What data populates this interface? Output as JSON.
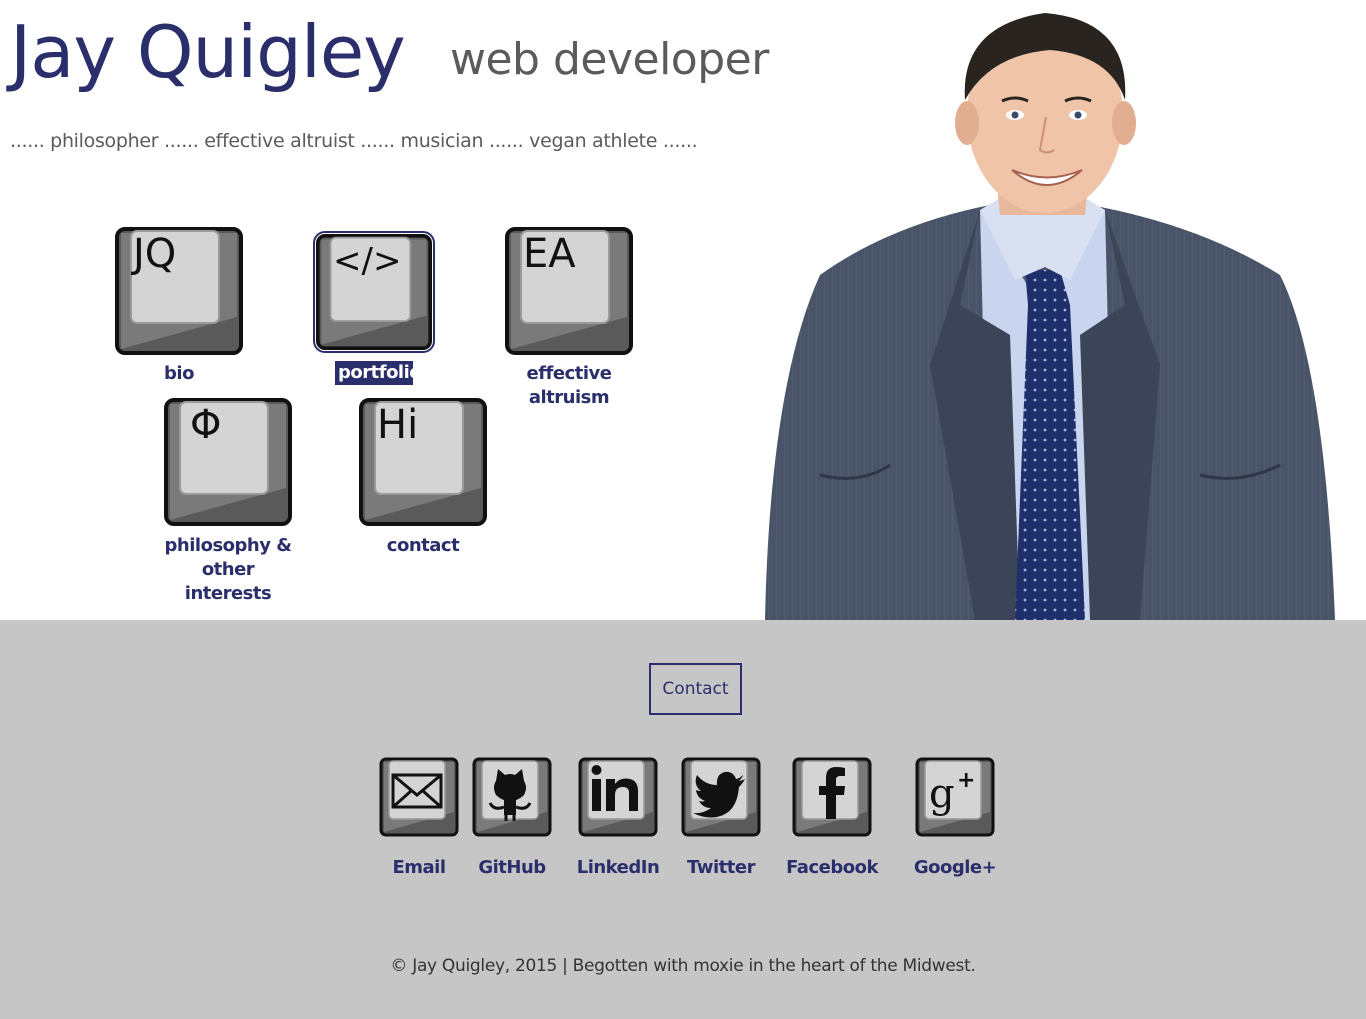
{
  "header": {
    "name": "Jay Quigley",
    "role": "web developer",
    "tagline": "...... philosopher ...... effective altruist ...... musician ...... vegan athlete ......"
  },
  "nav_keys": [
    {
      "legend": "JQ",
      "label": "bio",
      "icon": "jq-keycap-icon"
    },
    {
      "legend": "</>",
      "label": "portfolio",
      "icon": "code-keycap-icon",
      "active": true
    },
    {
      "legend": "EA",
      "label": "effective altruism",
      "icon": "ea-keycap-icon"
    },
    {
      "legend": "Φ",
      "label_line1": "philosophy &",
      "label_line2": "other interests",
      "icon": "phi-keycap-icon"
    },
    {
      "legend": "Hi",
      "label": "contact",
      "icon": "hi-keycap-icon"
    }
  ],
  "footer": {
    "contact_button": "Contact",
    "social": [
      {
        "label": "Email",
        "icon": "envelope-icon"
      },
      {
        "label": "GitHub",
        "icon": "octocat-icon"
      },
      {
        "label": "LinkedIn",
        "icon": "linkedin-icon"
      },
      {
        "label": "Twitter",
        "icon": "twitter-bird-icon"
      },
      {
        "label": "Facebook",
        "icon": "facebook-icon"
      },
      {
        "label": "Google+",
        "icon": "google-plus-icon"
      }
    ],
    "copyright": "© Jay Quigley, 2015 | Begotten with moxie in the heart of the Midwest."
  },
  "colors": {
    "brand": "#2a2f6b",
    "muted_text": "#5b5b5b",
    "footer_bg": "#c6c6c6"
  }
}
